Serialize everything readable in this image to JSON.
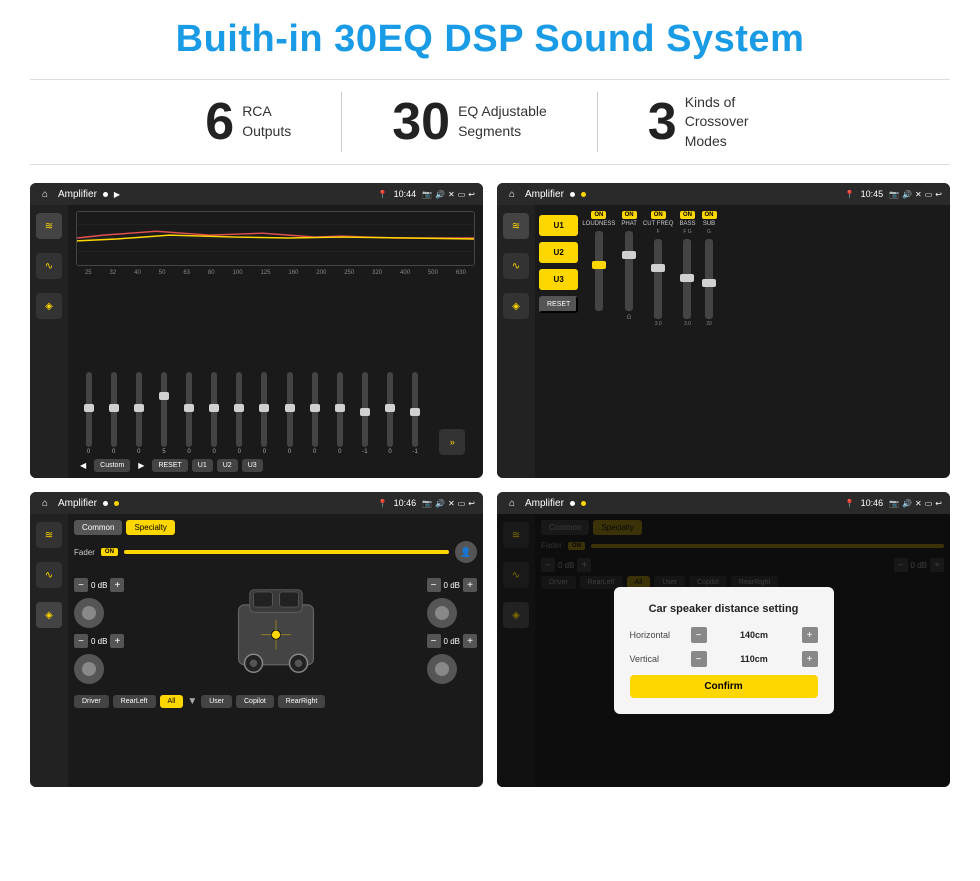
{
  "title": "Buith-in 30EQ DSP Sound System",
  "stats": [
    {
      "number": "6",
      "text": "RCA\nOutputs"
    },
    {
      "number": "30",
      "text": "EQ Adjustable\nSegments"
    },
    {
      "number": "3",
      "text": "Kinds of\nCrossover Modes"
    }
  ],
  "screens": [
    {
      "id": "screen1",
      "topbar": {
        "title": "Amplifier",
        "time": "10:44"
      },
      "type": "eq",
      "freqs": [
        "25",
        "32",
        "40",
        "50",
        "63",
        "80",
        "100",
        "125",
        "160",
        "200",
        "250",
        "320",
        "400",
        "500",
        "630"
      ],
      "values": [
        "0",
        "0",
        "0",
        "5",
        "0",
        "0",
        "0",
        "0",
        "0",
        "0",
        "0",
        "-1",
        "0",
        "-1"
      ],
      "preset": "Custom",
      "buttons": [
        "RESET",
        "U1",
        "U2",
        "U3"
      ]
    },
    {
      "id": "screen2",
      "topbar": {
        "title": "Amplifier",
        "time": "10:45"
      },
      "type": "amp",
      "uButtons": [
        "U1",
        "U2",
        "U3"
      ],
      "channels": [
        {
          "label": "LOUDNESS",
          "on": true
        },
        {
          "label": "PHAT",
          "on": true
        },
        {
          "label": "CUT FREQ",
          "on": true
        },
        {
          "label": "BASS",
          "on": true
        },
        {
          "label": "SUB",
          "on": true
        }
      ],
      "resetLabel": "RESET"
    },
    {
      "id": "screen3",
      "topbar": {
        "title": "Amplifier",
        "time": "10:46"
      },
      "type": "speaker",
      "tabs": [
        "Common",
        "Specialty"
      ],
      "activeTab": "Specialty",
      "faderLabel": "Fader",
      "faderOn": true,
      "dbs": [
        "0 dB",
        "0 dB",
        "0 dB",
        "0 dB"
      ],
      "bottomBtns": [
        "Driver",
        "RearLeft",
        "All",
        "User",
        "Copilot",
        "RearRight"
      ]
    },
    {
      "id": "screen4",
      "topbar": {
        "title": "Amplifier",
        "time": "10:46"
      },
      "type": "speaker-dialog",
      "dialogTitle": "Car speaker distance setting",
      "horizontal": {
        "label": "Horizontal",
        "value": "140cm"
      },
      "vertical": {
        "label": "Vertical",
        "value": "110cm"
      },
      "confirmLabel": "Confirm",
      "tabs": [
        "Common",
        "Specialty"
      ],
      "activeTab": "Specialty",
      "faderOn": true,
      "dbs": [
        "0 dB",
        "0 dB"
      ],
      "bottomBtns": [
        "Driver",
        "RearLeft",
        "All",
        "User",
        "Copilot",
        "RearRight"
      ]
    }
  ],
  "icons": {
    "home": "⌂",
    "eq_icon": "≋",
    "wave_icon": "∿",
    "speaker_icon": "◈",
    "arrow_left": "◀",
    "arrow_right": "▶",
    "expand": "»",
    "minus": "−",
    "plus": "+"
  }
}
